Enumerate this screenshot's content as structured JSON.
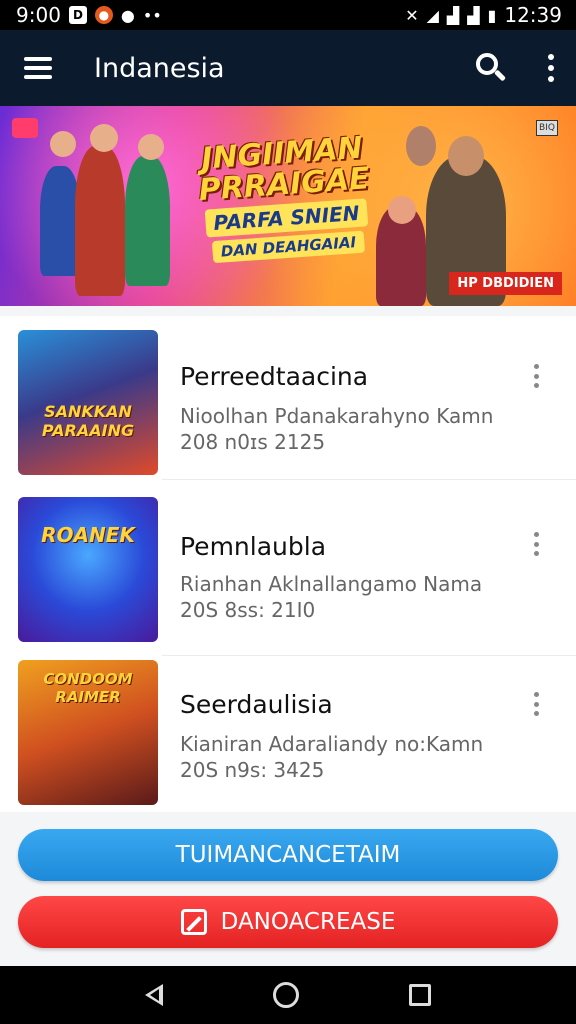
{
  "status_bar": {
    "time_left": "9:00",
    "time_right": "12:39"
  },
  "app_bar": {
    "title": "Indanesia"
  },
  "banner": {
    "title_line1": "JNGIIMAN",
    "title_line2": "PRRAIGAE",
    "sub_line1": "PARFA SNIEN",
    "sub_line2": "DAN DEAHGAIAI",
    "corner_tag": "HP DBDIDIEN",
    "corner_badge": "BIQ"
  },
  "list": {
    "items": [
      {
        "title": "Perreedtaacina",
        "subtitle": "Nioolhan Pdanakarahyno Kamn",
        "meta": "208 n0ɪs  2125",
        "thumb_text": "SANKKAN PARAAING",
        "thumb_colors": [
          "#e04a2a",
          "#2a8fd8"
        ]
      },
      {
        "title": "Pemnlaubla",
        "subtitle": "Rianhan Aklnallangamo Nama",
        "meta": "20S 8ss:  21I0",
        "thumb_text": "ROANEK",
        "thumb_colors": [
          "#2a6ae0",
          "#6a2ad8"
        ]
      },
      {
        "title": "Seerdaulisia",
        "subtitle": "Kianiran Adaraliandy no:Kamn",
        "meta": "20S n9s:  3425",
        "thumb_text": "CONDOOM RAIMER",
        "thumb_colors": [
          "#e07a1a",
          "#7a2a1a"
        ]
      }
    ]
  },
  "buttons": {
    "primary_label": "TUIMANCANCETAIM",
    "secondary_label": "DANOACREASE"
  }
}
